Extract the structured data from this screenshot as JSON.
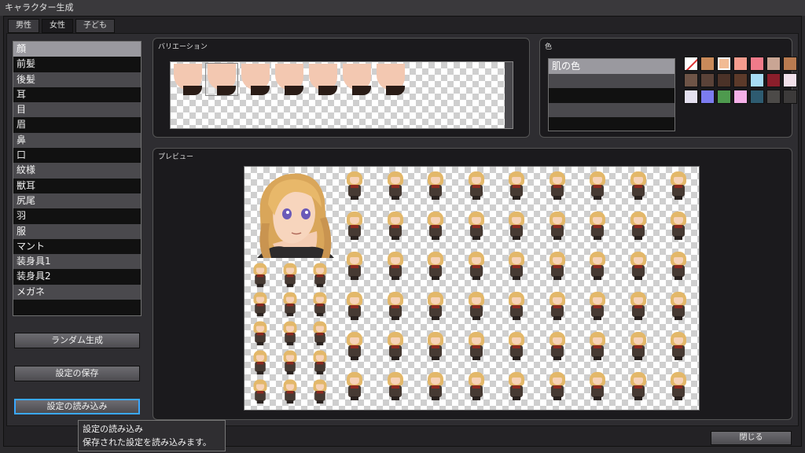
{
  "window_title": "キャラクター生成",
  "tabs": [
    {
      "label": "男性"
    },
    {
      "label": "女性"
    },
    {
      "label": "子ども"
    }
  ],
  "parts": [
    {
      "label": "顔"
    },
    {
      "label": "前髪"
    },
    {
      "label": "後髪"
    },
    {
      "label": "耳"
    },
    {
      "label": "目"
    },
    {
      "label": "眉"
    },
    {
      "label": "鼻"
    },
    {
      "label": "口"
    },
    {
      "label": "紋様"
    },
    {
      "label": "獣耳"
    },
    {
      "label": "尻尾"
    },
    {
      "label": "羽"
    },
    {
      "label": "服"
    },
    {
      "label": "マント"
    },
    {
      "label": "装身具1"
    },
    {
      "label": "装身具2"
    },
    {
      "label": "メガネ"
    }
  ],
  "selected_part": "顔",
  "buttons": {
    "random": "ランダム生成",
    "save": "設定の保存",
    "load": "設定の読み込み",
    "close": "閉じる"
  },
  "variation": {
    "title": "バリエーション",
    "count": 7,
    "selected_index": 1
  },
  "color": {
    "title": "色",
    "items": [
      "肌の色"
    ],
    "swatches": [
      "none",
      "#c98a5a",
      "#f2bb94",
      "#f59c8e",
      "#f07b8a",
      "#c9a594",
      "#b97b50",
      "#6e5447",
      "#5a4238",
      "#4b3228",
      "#5c3a2a",
      "#a7dcf5",
      "#8b1e2b",
      "#f1e0ea",
      "#e4e0f0",
      "#7c7cf0",
      "#4e9a4e",
      "#f5b0e8",
      "#2e5b70",
      "#4c4a48",
      "#3c3a3a"
    ],
    "selected_swatch": 2
  },
  "preview": {
    "title": "プレビュー"
  },
  "tooltip": {
    "line1": "設定の読み込み",
    "line2": "保存された設定を読み込みます。"
  }
}
